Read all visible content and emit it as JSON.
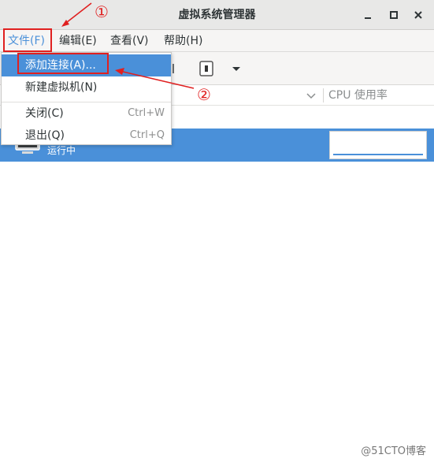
{
  "window": {
    "title": "虚拟系统管理器"
  },
  "menubar": {
    "items": [
      {
        "label": "文件(F)"
      },
      {
        "label": "编辑(E)"
      },
      {
        "label": "查看(V)"
      },
      {
        "label": "帮助(H)"
      }
    ]
  },
  "file_menu": {
    "items": [
      {
        "label": "添加连接(A)...",
        "accel": ""
      },
      {
        "label": "新建虚拟机(N)",
        "accel": ""
      },
      {
        "label": "关闭(C)",
        "accel": "Ctrl+W"
      },
      {
        "label": "退出(Q)",
        "accel": "Ctrl+Q"
      }
    ]
  },
  "table": {
    "cpu_header": "CPU 使用率",
    "rows": [
      {
        "status": "运行中"
      }
    ]
  },
  "annotations": {
    "marker1": "①",
    "marker2": "②"
  },
  "watermark": "@51CTO博客",
  "colors": {
    "accent": "#4a90d9",
    "annotation": "#e02020"
  }
}
